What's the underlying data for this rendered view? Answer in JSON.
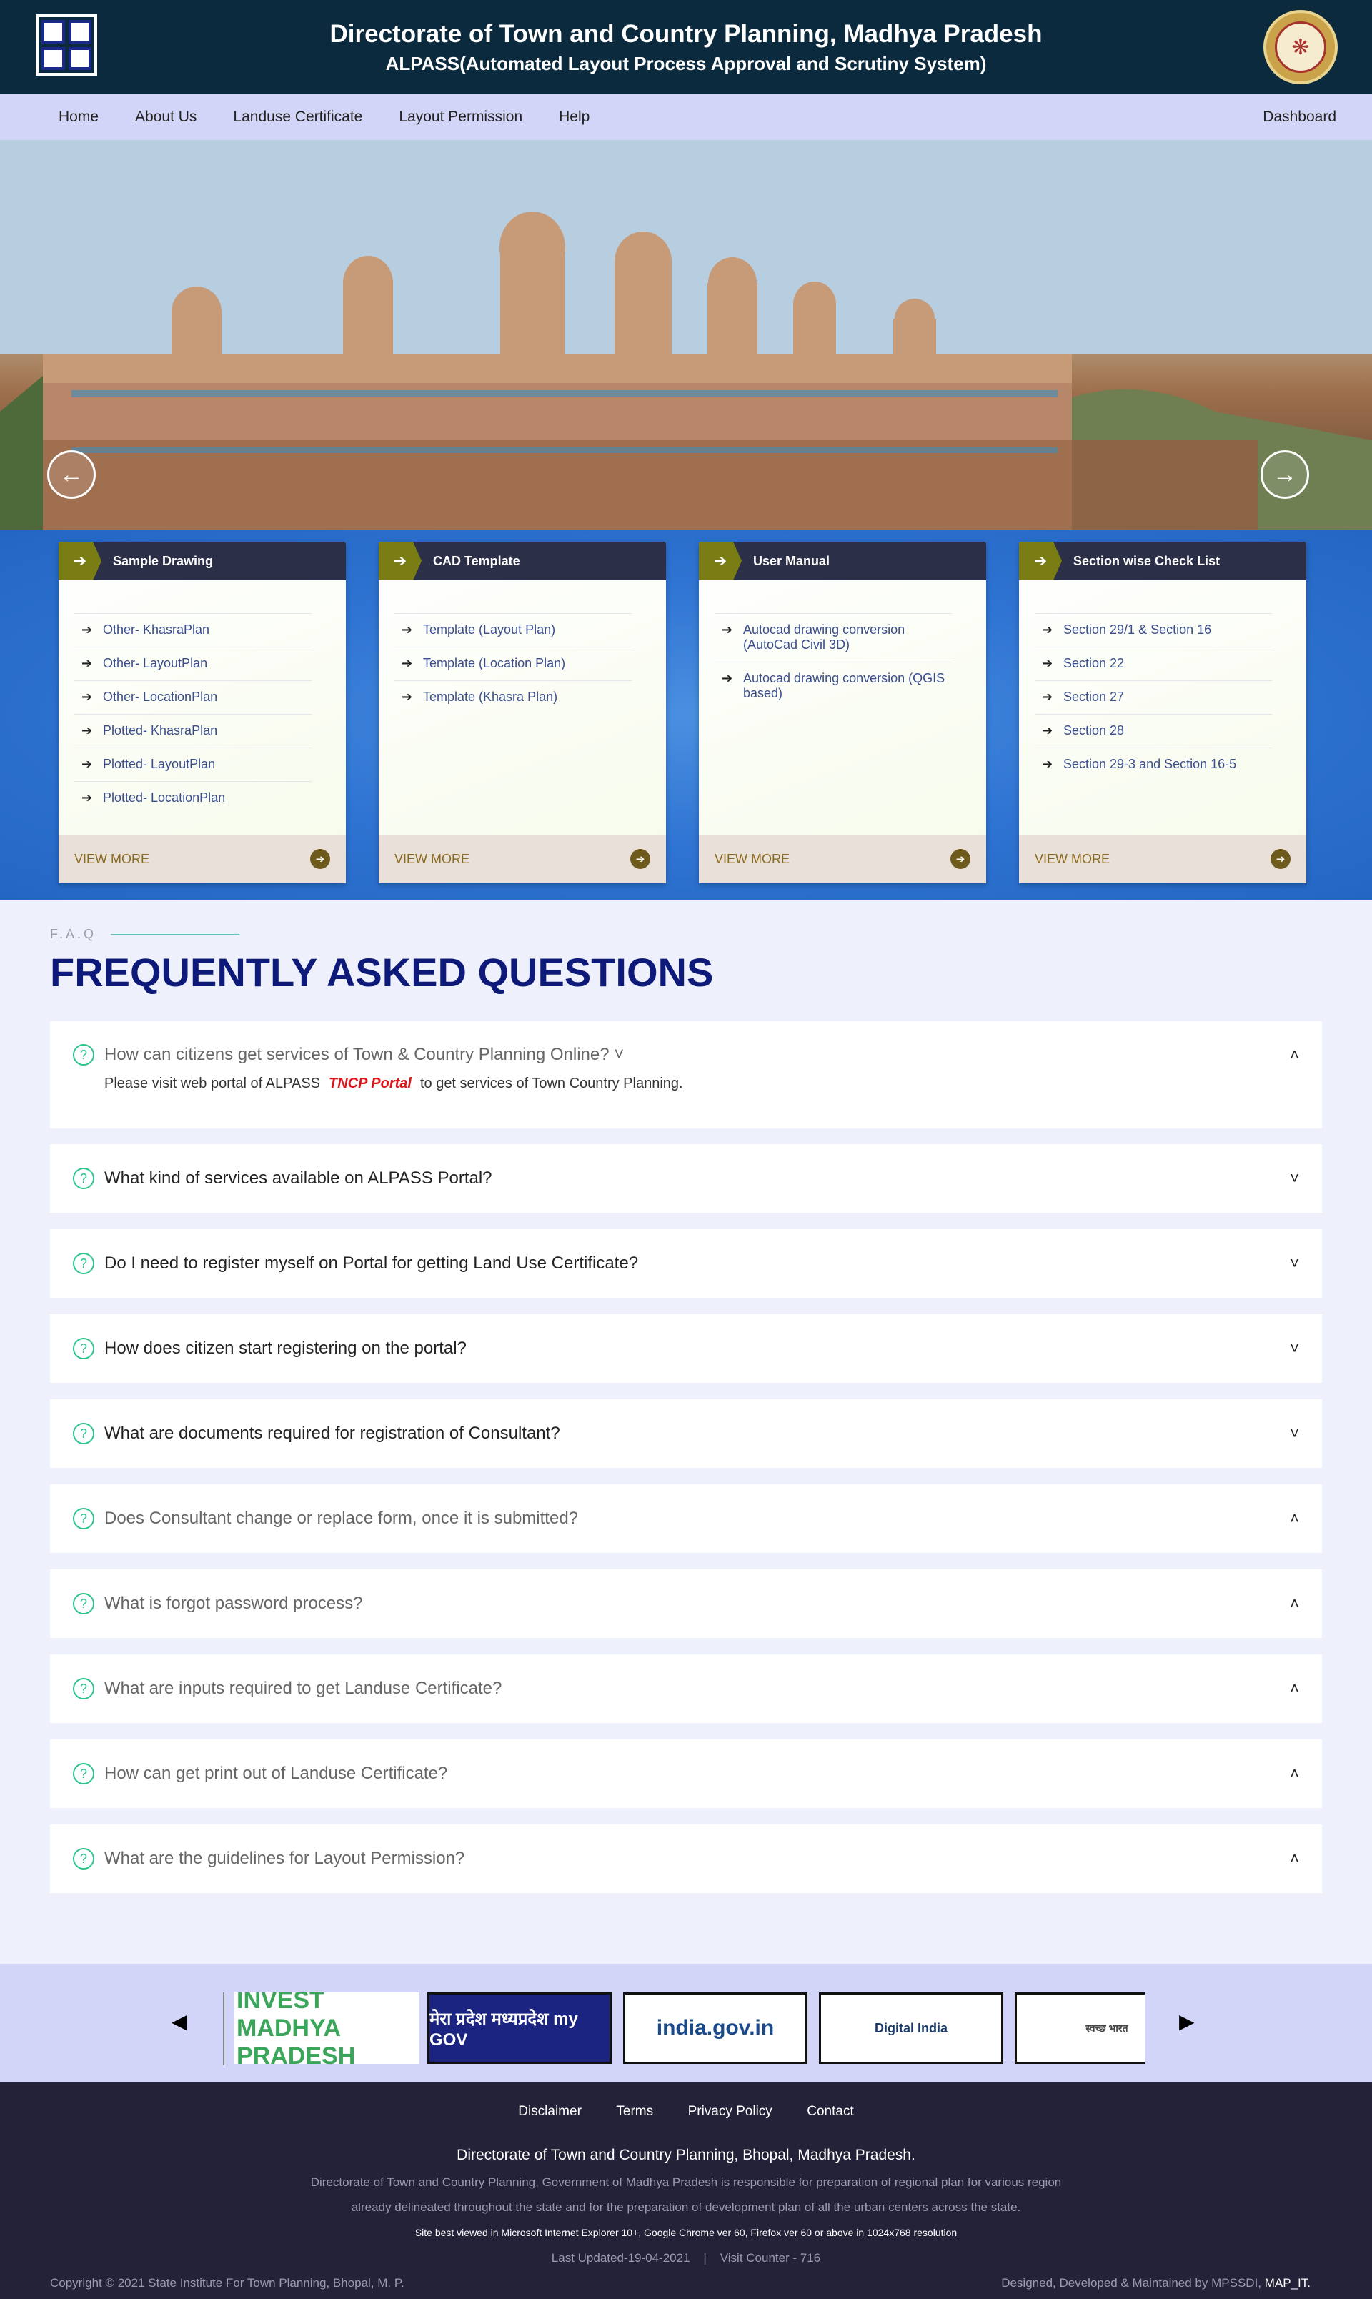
{
  "header": {
    "title": "Directorate of Town and Country Planning, Madhya Pradesh",
    "subtitle": "ALPASS(Automated Layout Process Approval and Scrutiny System)"
  },
  "nav": {
    "items": [
      "Home",
      "About Us",
      "Landuse Certificate",
      "Layout Permission",
      "Help"
    ],
    "dashboard": "Dashboard"
  },
  "slider": {
    "prev_icon": "←",
    "next_icon": "→"
  },
  "cards": [
    {
      "title": "Sample Drawing",
      "items": [
        "Other- KhasraPlan",
        "Other- LayoutPlan",
        "Other- LocationPlan",
        "Plotted- KhasraPlan",
        "Plotted- LayoutPlan",
        "Plotted- LocationPlan"
      ],
      "footer": "VIEW MORE"
    },
    {
      "title": "CAD Template",
      "items": [
        "Template (Layout Plan)",
        "Template (Location Plan)",
        "Template (Khasra Plan)"
      ],
      "footer": "VIEW MORE"
    },
    {
      "title": "User Manual",
      "items": [
        "Autocad drawing conversion (AutoCad Civil 3D)",
        "Autocad drawing conversion (QGIS based)"
      ],
      "footer": "VIEW MORE"
    },
    {
      "title": "Section wise Check List",
      "items": [
        "Section 29/1 & Section 16",
        "Section 22",
        "Section 27",
        "Section 28",
        "Section 29-3 and Section 16-5"
      ],
      "footer": "VIEW MORE"
    }
  ],
  "faq": {
    "tag": "F.A.Q",
    "title": "FREQUENTLY ASKED QUESTIONS",
    "items": [
      {
        "q": "How can citizens get services of Town & Country Planning Online? ˅",
        "a_pre": "Please visit web portal of ALPASS",
        "a_link": "TNCP Portal",
        "a_post": "to get services of Town Country Planning.",
        "chev": "˄"
      },
      {
        "q": "What kind of services available on ALPASS Portal?",
        "chev": "˅"
      },
      {
        "q": "Do I need to register myself on Portal for getting Land Use Certificate?",
        "chev": "˅"
      },
      {
        "q": "How does citizen start registering on the portal?",
        "chev": "˅"
      },
      {
        "q": "What are documents required for registration of Consultant?",
        "chev": "˅"
      },
      {
        "q": "Does Consultant change or replace form, once it is submitted?",
        "chev": "˄"
      },
      {
        "q": "What is forgot password process?",
        "chev": "˄"
      },
      {
        "q": "What are inputs required to get Landuse Certificate?",
        "chev": "˄"
      },
      {
        "q": "How can get print out of Landuse Certificate?",
        "chev": "˄"
      },
      {
        "q": "What are the guidelines for Layout Permission?",
        "chev": "˄"
      }
    ]
  },
  "partners": {
    "logos": [
      "INVEST MADHYA PRADESH",
      "मेरा प्रदेश मध्यप्रदेश my GOV",
      "india.gov.in",
      "Digital India",
      "स्वच्छ भारत"
    ]
  },
  "footer": {
    "links": [
      "Disclaimer",
      "Terms",
      "Privacy Policy",
      "Contact"
    ],
    "org": "Directorate of Town and Country Planning, Bhopal, Madhya Pradesh.",
    "desc1": "Directorate of Town and Country Planning, Government of Madhya Pradesh is responsible for preparation of regional plan for various region",
    "desc2": "already delineated throughout the state and for the preparation of development plan of all the urban centers across the state.",
    "best_viewed": "Site best viewed in Microsoft Internet Explorer 10+, Google Chrome ver 60, Firefox ver 60 or above in 1024x768 resolution",
    "updated": "Last Updated-19-04-2021    |    Visit Counter - 716",
    "copyright": "Copyright © 2021 State Institute For Town Planning, Bhopal, M. P.",
    "credit_pre": "Designed, Developed & Maintained by MPSSDI,",
    "credit_link": "MAP_IT."
  }
}
